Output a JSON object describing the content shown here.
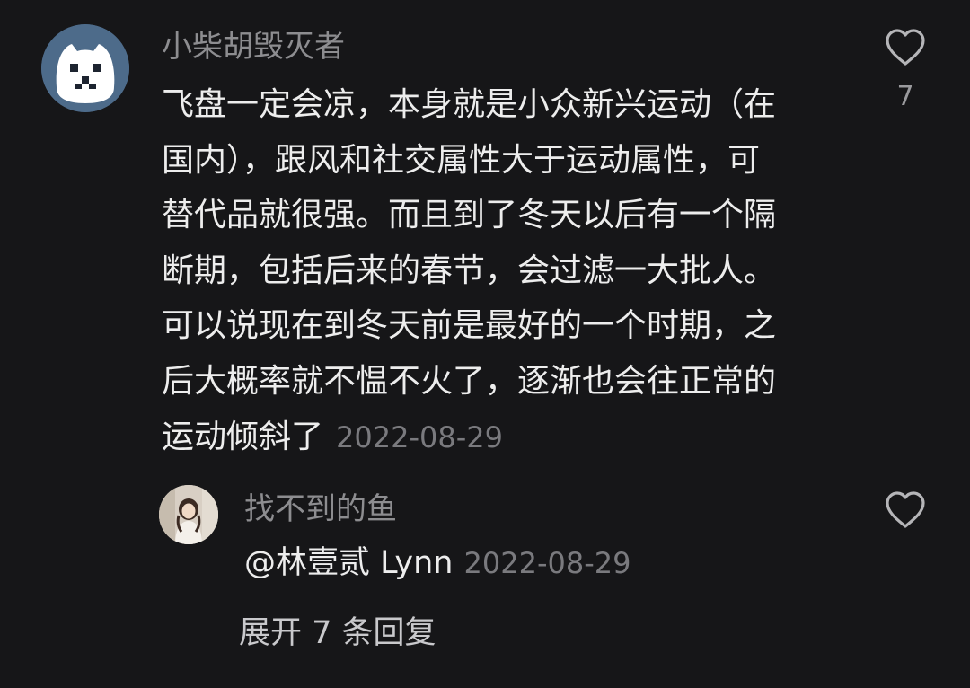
{
  "comment": {
    "username": "小柴胡毁灭者",
    "avatar_icon": "cat-face-icon",
    "lines": [
      "飞盘一定会凉，本身就是小众新兴运动（在",
      "国内），跟风和社交属性大于运动属性，可",
      "替代品就很强。而且到了冬天以后有一个隔",
      "断期，包括后来的春节，会过滤一大批人。",
      "可以说现在到冬天前是最好的一个时期，之",
      "后大概率就不愠不火了，逐渐也会往正常的",
      "运动倾斜了"
    ],
    "date": "2022-08-29",
    "likes": "7",
    "like_icon": "heart-outline-icon"
  },
  "reply": {
    "username": "找不到的鱼",
    "avatar_icon": "user-photo-avatar",
    "text": "@林壹贰 Lynn",
    "date": "2022-08-29",
    "like_icon": "heart-outline-icon"
  },
  "expand": {
    "label": "展开 7 条回复"
  },
  "colors": {
    "background": "#161618",
    "text_primary": "#ededed",
    "text_secondary": "#8d8d90",
    "avatar_blue": "#4d6b8a"
  }
}
